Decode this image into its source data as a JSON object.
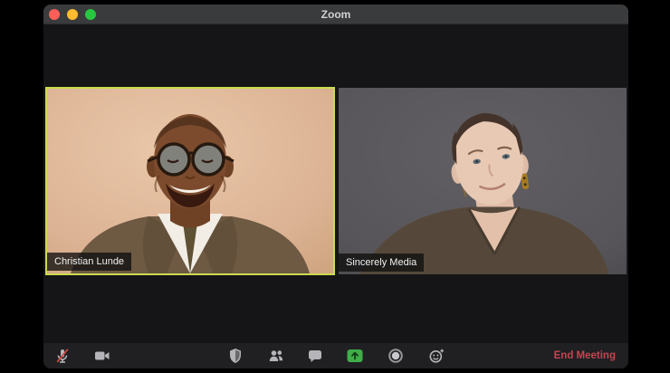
{
  "window": {
    "title": "Zoom",
    "traffic_lights": [
      "close",
      "minimize",
      "zoom"
    ]
  },
  "participants": [
    {
      "name": "Christian Lunde",
      "active_speaker": true
    },
    {
      "name": "Sincerely Media",
      "active_speaker": false
    }
  ],
  "toolbar": {
    "buttons": [
      {
        "id": "mute",
        "icon": "mic-off-icon",
        "state": "muted"
      },
      {
        "id": "start-video",
        "icon": "video-camera-icon",
        "state": "on"
      },
      {
        "id": "security",
        "icon": "shield-icon"
      },
      {
        "id": "participants",
        "icon": "participants-icon"
      },
      {
        "id": "chat",
        "icon": "chat-bubble-icon"
      },
      {
        "id": "share-screen",
        "icon": "share-screen-icon"
      },
      {
        "id": "record",
        "icon": "record-icon"
      },
      {
        "id": "reactions",
        "icon": "reactions-icon"
      }
    ],
    "end_meeting_label": "End Meeting"
  },
  "colors": {
    "active_speaker_border": "#cbdb4e",
    "share_screen_green": "#3fae49",
    "end_meeting_text": "#c2454f",
    "titlebar_bg": "#3a3b3d",
    "toolbar_bg": "#202023",
    "stage_bg": "#151517",
    "mute_slash_red": "#cf4a3f",
    "traffic_red": "#ff5f57",
    "traffic_yellow": "#febc2e",
    "traffic_green": "#28c840"
  }
}
